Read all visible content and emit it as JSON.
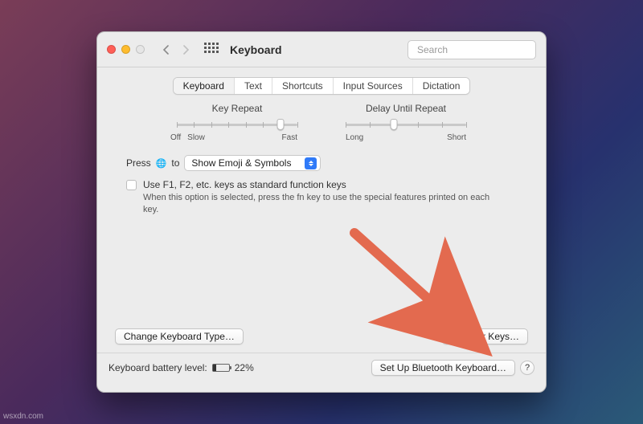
{
  "window": {
    "title": "Keyboard"
  },
  "search": {
    "placeholder": "Search"
  },
  "tabs": {
    "items": [
      "Keyboard",
      "Text",
      "Shortcuts",
      "Input Sources",
      "Dictation"
    ],
    "selected": 0
  },
  "sliders": {
    "key_repeat": {
      "label": "Key Repeat",
      "legendLeft": "Off",
      "legendLeft2": "Slow",
      "legendRight": "Fast",
      "ticks": 8,
      "value": 6
    },
    "delay_until_repeat": {
      "label": "Delay Until Repeat",
      "legendLeft": "Long",
      "legendRight": "Short",
      "ticks": 6,
      "value": 2
    }
  },
  "press_row": {
    "prefix": "Press",
    "suffix": "to",
    "select_value": "Show Emoji & Symbols"
  },
  "fn_keys": {
    "checkbox_label": "Use F1, F2, etc. keys as standard function keys",
    "description": "When this option is selected, press the fn key to use the special features printed on each key.",
    "checked": false
  },
  "buttons": {
    "change_keyboard": "Change Keyboard Type…",
    "modifier_keys": "Modifier Keys…",
    "bluetooth": "Set Up Bluetooth Keyboard…",
    "help": "?"
  },
  "battery": {
    "label_prefix": "Keyboard battery level:",
    "percent_label": "22%",
    "percent_value": 22
  },
  "annotation": {
    "arrow_color": "#e36a4f"
  },
  "watermark": "wsxdn.com"
}
